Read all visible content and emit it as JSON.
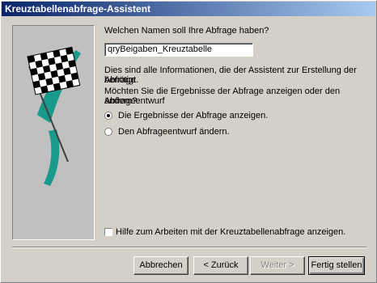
{
  "window": {
    "title": "Kreuztabellenabfrage-Assistent"
  },
  "form": {
    "name_prompt": "Welchen Namen soll Ihre Abfrage haben?",
    "name_value": "qryBeigaben_Kreuztabelle",
    "info_line1": "Dies sind alle Informationen, die der Assistent zur Erstellung der Abfrage",
    "info_line2": "benötigt.",
    "question_line1": "Möchten Sie die Ergebnisse der Abfrage anzeigen oder den Abfrageentwurf",
    "question_line2": "ändern?",
    "radio_show": "Die Ergebnisse der Abfrage anzeigen.",
    "radio_modify": "Den Abfrageentwurf ändern.",
    "help_checkbox": "Hilfe zum Arbeiten mit der Kreuztabellenabfrage anzeigen."
  },
  "buttons": {
    "cancel": "Abbrechen",
    "back": "< Zurück",
    "next": "Weiter >",
    "finish": "Fertig stellen"
  }
}
